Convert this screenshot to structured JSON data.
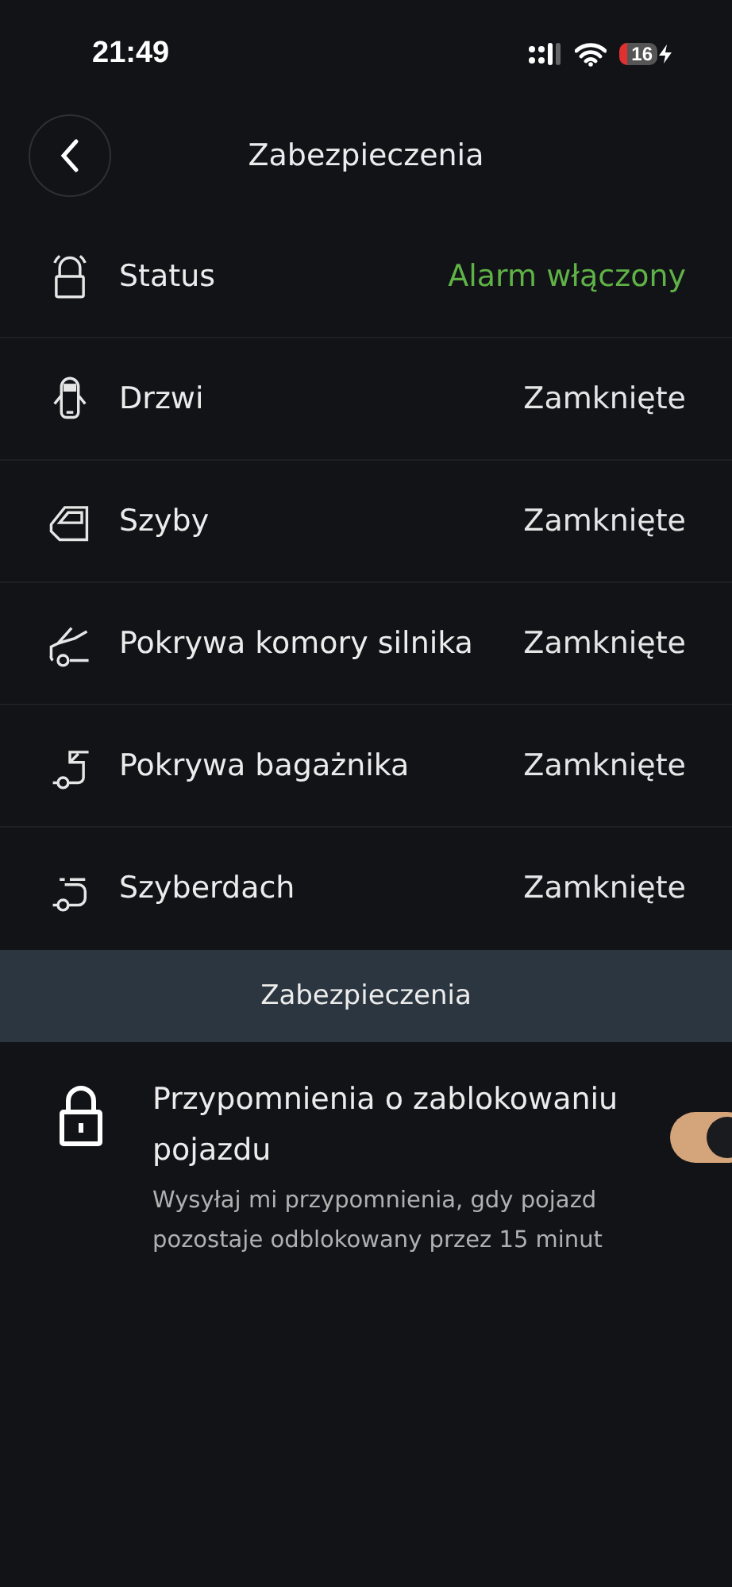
{
  "status_bar": {
    "time": "21:49",
    "battery": "16"
  },
  "header": {
    "title": "Zabezpieczenia"
  },
  "rows": [
    {
      "kind": "lock",
      "label": "Status",
      "value": "Alarm włączony",
      "color": "#5fb346"
    },
    {
      "kind": "door",
      "label": "Drzwi",
      "value": "Zamknięte",
      "color": "#e6e6e6"
    },
    {
      "kind": "window",
      "label": "Szyby",
      "value": "Zamknięte",
      "color": "#e6e6e6"
    },
    {
      "kind": "hood",
      "label": "Pokrywa komory silnika",
      "value": "Zamknięte",
      "color": "#e6e6e6"
    },
    {
      "kind": "trunk",
      "label": "Pokrywa bagażnika",
      "value": "Zamknięte",
      "color": "#e6e6e6"
    },
    {
      "kind": "sunroof",
      "label": "Szyberdach",
      "value": "Zamknięte",
      "color": "#e6e6e6"
    }
  ],
  "section": {
    "title": "Zabezpieczenia"
  },
  "reminder": {
    "title": "Przypomnienia o zablokowaniu pojazdu",
    "description": "Wysyłaj mi przypomnienia, gdy pojazd pozostaje odblokowany przez 15 minut",
    "on": true
  }
}
